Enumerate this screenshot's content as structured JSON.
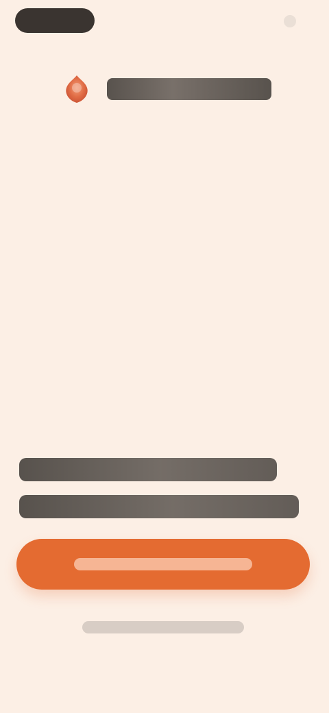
{
  "app": {
    "title": ""
  },
  "status_bar": {
    "pill_label": "",
    "indicator_label": ""
  },
  "brand": {
    "logo_icon": "brand-logo-icon",
    "wordmark": ""
  },
  "hero": {
    "headline_line1": "",
    "headline_line2": ""
  },
  "actions": {
    "primary_button_label": "",
    "secondary_link_label": ""
  },
  "colors": {
    "background": "#fcefe5",
    "accent": "#e46b31",
    "text_dark": "#4f4a45"
  }
}
